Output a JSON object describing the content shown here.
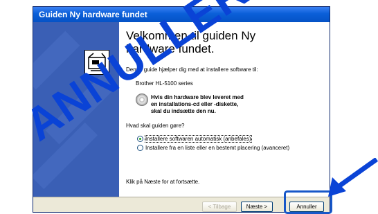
{
  "window": {
    "title": "Guiden Ny hardware fundet"
  },
  "content": {
    "heading": "Velkommen til guiden Ny hardware fundet.",
    "intro": "Denne guide hjælper dig med at installere software til:",
    "device": "Brother HL-5100 series",
    "cd_prompt": [
      "Hvis din hardware blev leveret med",
      "en installations-cd eller -diskette,",
      "skal du indsætte den nu."
    ],
    "question": "Hvad skal guiden gøre?",
    "options": [
      {
        "label": "Installere softwaren automatisk (anbefales)",
        "selected": true
      },
      {
        "label": "Installere fra en liste eller en bestemt placering (avanceret)",
        "selected": false
      }
    ],
    "continue_hint": "Klik på Næste for at fortsætte."
  },
  "buttons": {
    "back": "< Tilbage",
    "next": "Næste >",
    "cancel": "Annuller"
  },
  "annotation": {
    "watermark": "ANNULLER",
    "color": "#0a43d6"
  }
}
